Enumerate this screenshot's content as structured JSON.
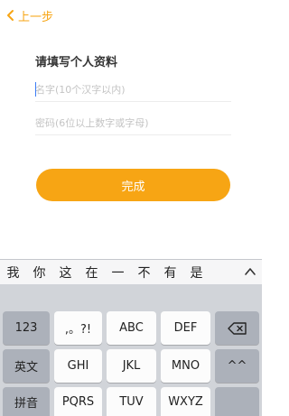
{
  "header": {
    "back_label": "上一步"
  },
  "form": {
    "title": "请填写个人资料",
    "name_placeholder": "名字(10个汉字以内)",
    "password_placeholder": "密码(6位以上数字或字母)",
    "submit_label": "完成"
  },
  "keyboard": {
    "candidates": [
      "我",
      "你",
      "这",
      "在",
      "一",
      "不",
      "有",
      "是"
    ],
    "keys": {
      "k123": "123",
      "punct": ",。?!",
      "abc": "ABC",
      "def": "DEF",
      "english": "英文",
      "ghi": "GHI",
      "jkl": "JKL",
      "mno": "MNO",
      "face": "^^",
      "pinyin": "拼音",
      "pqrs": "PQRS",
      "tuv": "TUV",
      "wxyz": "WXYZ"
    }
  },
  "colors": {
    "accent": "#f7a514",
    "caret": "#3b7cf6",
    "keyboard_bg": "#d1d4d9"
  }
}
